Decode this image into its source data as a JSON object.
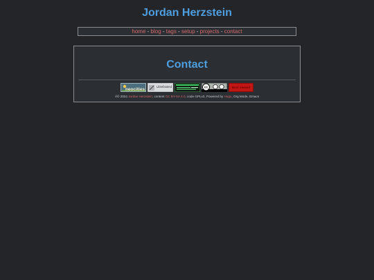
{
  "site": {
    "title": "Jordan Herzstein"
  },
  "nav": {
    "items": [
      {
        "label": "home"
      },
      {
        "label": "blog"
      },
      {
        "label": "tags"
      },
      {
        "label": "setup"
      },
      {
        "label": "projects"
      },
      {
        "label": "contact"
      }
    ],
    "separator": " - "
  },
  "page": {
    "title": "Contact"
  },
  "badges": {
    "neocities": "neocities",
    "librebooted": "Librebooted",
    "cc": "cc",
    "best_viewed": "Best viewed"
  },
  "footer": {
    "prefix": "Â© 2024 ",
    "author": "Jordan Herzstein",
    "content_label": ", content ",
    "license": "CC BY-SA 4.0",
    "code_label": ", code GPLv3, Powered by ",
    "hugo": "Hugo",
    "suffix": ", Org Mode, Emacs"
  },
  "colors": {
    "background": "#232529",
    "accent_blue": "#4e9ee0",
    "link_red": "#d46a6a"
  }
}
